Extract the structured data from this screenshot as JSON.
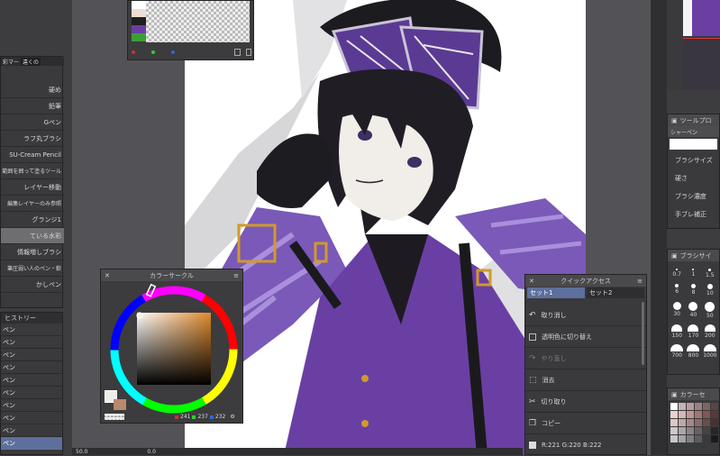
{
  "canvas": {
    "zoom": "50.0",
    "angle": "0.0"
  },
  "left_panel": {
    "tabs": [
      "彩マー",
      "違くの"
    ],
    "brushes": [
      {
        "label": "硬め"
      },
      {
        "label": "鉛筆"
      },
      {
        "label": "Gペン"
      },
      {
        "label": "ラフ丸ブラシ"
      },
      {
        "label": "SU-Cream Pencil"
      },
      {
        "label": "範囲を囲って塗るツール"
      },
      {
        "label": "レイヤー移動"
      },
      {
        "label": "編集レイヤーのみ参照"
      },
      {
        "label": "グランジ1"
      },
      {
        "label": "ている水彩"
      },
      {
        "label": "情報増しブラシ"
      },
      {
        "label": "筆圧弱い人のペン・軟"
      },
      {
        "label": "かしペン"
      }
    ],
    "history_title": "ヒストリー",
    "history_items": [
      "ペン",
      "ペン",
      "ペン",
      "ペン",
      "ペン",
      "ペン",
      "ペン",
      "ペン",
      "ペン",
      "ペン"
    ]
  },
  "color_circle": {
    "title": "カラーサークル",
    "r": "241",
    "g": "237",
    "b": "232"
  },
  "quick_access": {
    "title": "クイックアクセス",
    "tabs": [
      "セット1",
      "セット2"
    ],
    "items": [
      {
        "label": "取り消し",
        "icon": "undo-icon",
        "enabled": true
      },
      {
        "label": "透明色に切り替え",
        "icon": "transparent-swatch-icon",
        "enabled": true
      },
      {
        "label": "やり直し",
        "icon": "redo-icon",
        "enabled": false
      },
      {
        "label": "消去",
        "icon": "clear-icon",
        "enabled": true
      },
      {
        "label": "切り取り",
        "icon": "scissors-icon",
        "enabled": true
      },
      {
        "label": "コピー",
        "icon": "copy-icon",
        "enabled": true
      },
      {
        "label": "R:221 G:220 B:222",
        "icon": "color-swatch-icon",
        "enabled": true
      }
    ]
  },
  "tool_property": {
    "title": "ツールプロ",
    "tool_name": "シャーペン",
    "rows": [
      {
        "label": "ブラシサイズ"
      },
      {
        "label": "硬さ"
      },
      {
        "label": "ブラシ濃度"
      },
      {
        "label": "手ブレ補正"
      }
    ]
  },
  "brush_size": {
    "title": "ブラシサイ",
    "sizes": [
      "0.7",
      "1",
      "1.5",
      "6",
      "8",
      "10",
      "30",
      "40",
      "50",
      "150",
      "170",
      "200",
      "700",
      "800",
      "1000"
    ]
  },
  "color_set": {
    "title": "カラーセ"
  },
  "colors": {
    "accent_selected": "#5d6f9c",
    "purple": "#6a3fa4",
    "hue_handle": "#e08a2c"
  }
}
